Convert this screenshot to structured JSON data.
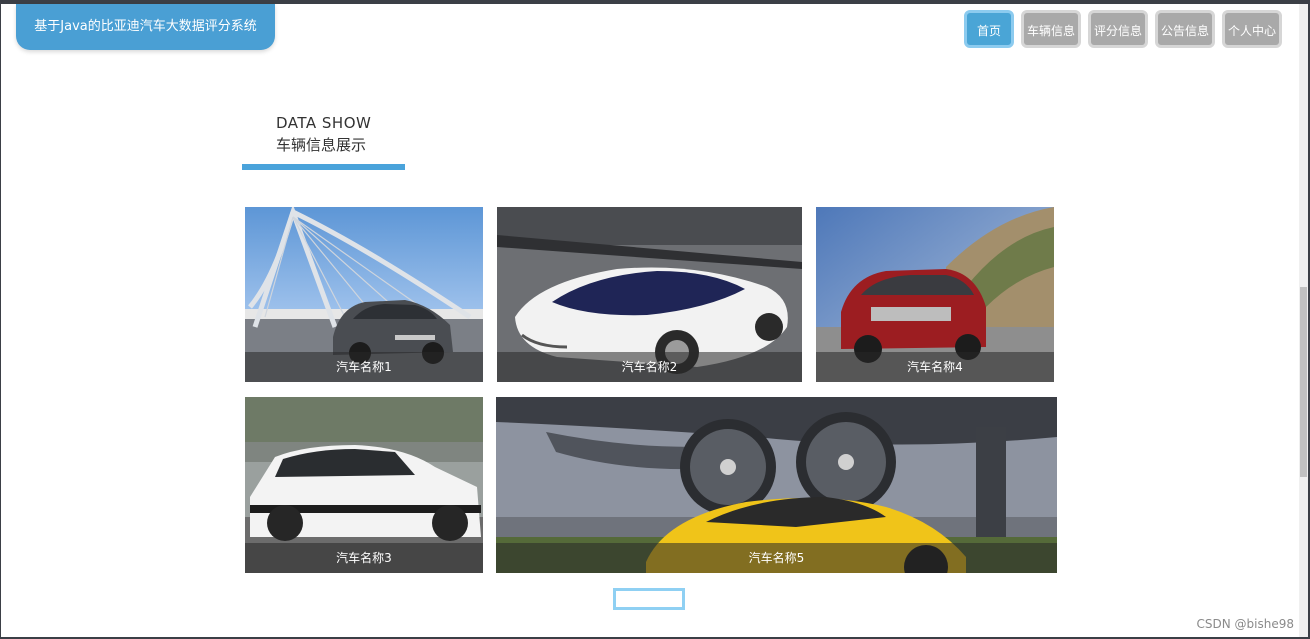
{
  "header": {
    "site_title": "基于Java的比亚迪汽车大数据评分系统",
    "nav": [
      {
        "label": "首页",
        "active": true
      },
      {
        "label": "车辆信息"
      },
      {
        "label": "评分信息"
      },
      {
        "label": "公告信息"
      },
      {
        "label": "个人中心"
      }
    ]
  },
  "section": {
    "title_en": "DATA SHOW",
    "title_cn": "车辆信息展示"
  },
  "cards": [
    {
      "caption": "汽车名称1"
    },
    {
      "caption": "汽车名称2"
    },
    {
      "caption": "汽车名称4"
    },
    {
      "caption": "汽车名称3"
    },
    {
      "caption": "汽车名称5"
    }
  ],
  "watermark": "CSDN @bishe98",
  "colors": {
    "accent": "#4aa5d6",
    "nav_inactive": "#a9a9a9"
  }
}
